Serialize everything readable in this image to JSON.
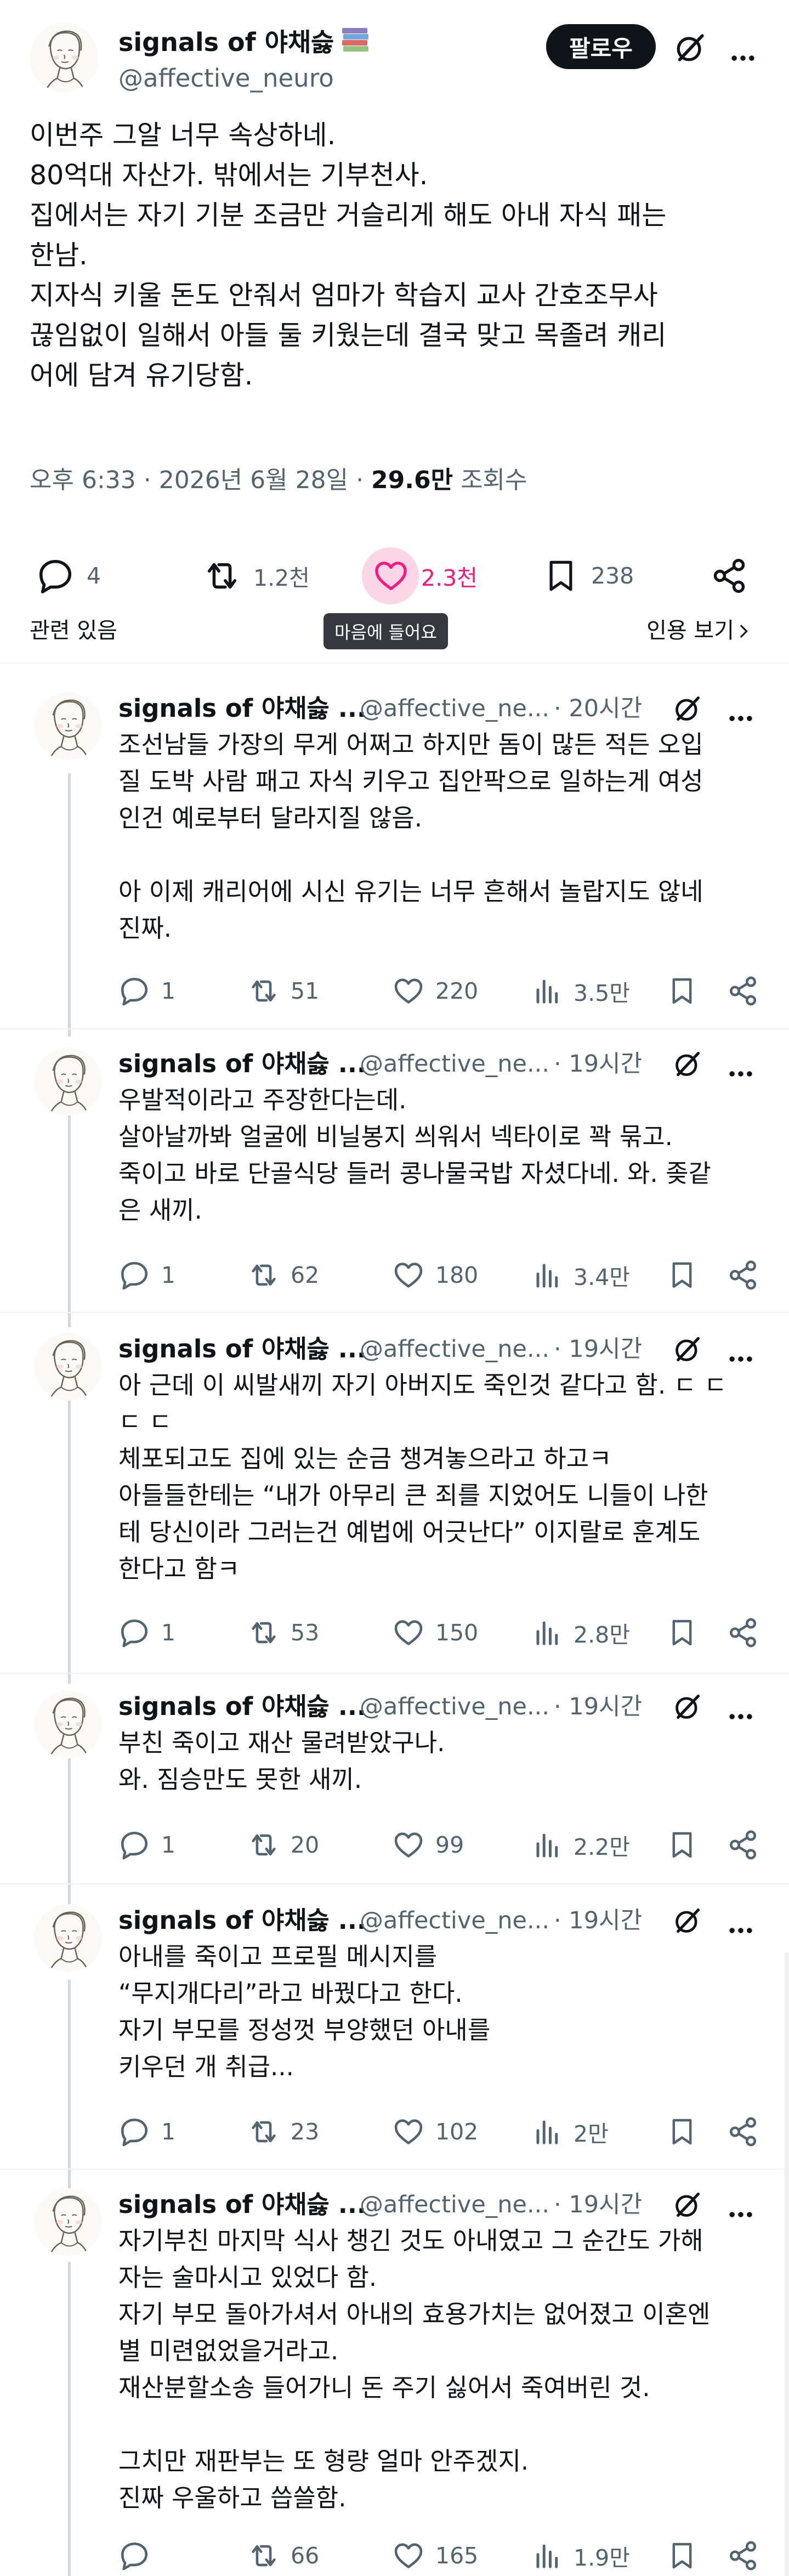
{
  "post": {
    "author_name": "signals of 야채슳",
    "author_handle": "@affective_neuro",
    "follow_label": "팔로우",
    "text_lines": [
      "이번주 그알 너무 속상하네.",
      "80억대 자산가. 밖에서는 기부천사.",
      "집에서는 자기 기분 조금만 거슬리게 해도 아내 자식 패는",
      "한남.",
      "지자식 키울 돈도 안줘서 엄마가 학습지 교사 간호조무사",
      "끊임없이 일해서 아들 둘 키웠는데 결국 맞고 목졸려 캐리",
      "어에 담겨 유기당함."
    ],
    "time": "오후 6:33 · 2026년 6월 28일 · ",
    "views_count": "29.6만",
    "views_label": " 조회수",
    "actions": {
      "replies": "4",
      "reposts": "1.2천",
      "likes": "2.3천",
      "bookmarks": "238"
    },
    "related_label": "관련 있음",
    "like_tooltip": "마음에 들어요",
    "quotes_label": "인용 보기"
  },
  "replies": [
    {
      "name": "signals of 야채슳 ...",
      "handle": "@affective_ne...",
      "time": "· 20시간",
      "text_lines": [
        "조선남들 가장의 무게 어쩌고 하지만 돔이 많든 적든 오입",
        "질 도박 사람 패고 자식 키우고 집안팍으로 일하는게 여성",
        "인건 예로부터 달라지질 않음.",
        "",
        "아 이제 캐리어에 시신 유기는 너무 흔해서 놀랍지도 않네",
        "진짜."
      ],
      "stats": {
        "replies": "1",
        "reposts": "51",
        "likes": "220",
        "views": "3.5만"
      }
    },
    {
      "name": "signals of 야채슳 ...",
      "handle": "@affective_ne...",
      "time": "· 19시간",
      "text_lines": [
        "우발적이라고 주장한다는데.",
        "살아날까봐 얼굴에 비닐봉지 씌워서 넥타이로 꽉 묶고.",
        "죽이고 바로 단골식당 들러 콩나물국밥 자셨다네. 와. 좆같",
        "은 새끼."
      ],
      "stats": {
        "replies": "1",
        "reposts": "62",
        "likes": "180",
        "views": "3.4만"
      }
    },
    {
      "name": "signals of 야채슳 ...",
      "handle": "@affective_ne...",
      "time": "· 19시간",
      "text_lines": [
        "아 근데 이 씨발새끼 자기 아버지도 죽인것 같다고 함. ㄷ ㄷ",
        "ㄷ ㄷ",
        "체포되고도 집에 있는 순금 챙겨놓으라고 하고ㅋ",
        "아들들한테는 “내가 아무리 큰 죄를 지었어도 니들이 나한",
        "테 당신이라 그러는건 예법에 어긋난다” 이지랄로 훈계도",
        "한다고 함ㅋ"
      ],
      "stats": {
        "replies": "1",
        "reposts": "53",
        "likes": "150",
        "views": "2.8만"
      }
    },
    {
      "name": "signals of 야채슳 ...",
      "handle": "@affective_ne...",
      "time": "· 19시간",
      "text_lines": [
        "부친 죽이고 재산 물려받았구나.",
        "와. 짐승만도 못한 새끼."
      ],
      "stats": {
        "replies": "1",
        "reposts": "20",
        "likes": "99",
        "views": "2.2만"
      }
    },
    {
      "name": "signals of 야채슳 ...",
      "handle": "@affective_ne...",
      "time": "· 19시간",
      "text_lines": [
        "아내를 죽이고 프로필 메시지를",
        "“무지개다리”라고 바꿨다고 한다.",
        "자기 부모를 정성껏 부양했던 아내를",
        "키우던 개 취급..."
      ],
      "stats": {
        "replies": "1",
        "reposts": "23",
        "likes": "102",
        "views": "2만"
      }
    },
    {
      "name": "signals of 야채슳 ...",
      "handle": "@affective_ne...",
      "time": "· 19시간",
      "text_lines": [
        "자기부친 마지막 식사 챙긴 것도 아내였고 그 순간도 가해",
        "자는 술마시고 있었다 함.",
        "자기 부모 돌아가셔서 아내의 효용가치는 없어졌고 이혼엔",
        "별 미련없었을거라고.",
        "재산분할소송 들어가니 돈 주기 싫어서 죽여버린 것.",
        "",
        "그치만 재판부는 또 형량 얼마 안주겠지.",
        "진짜 우울하고 씁쓸함."
      ],
      "stats": {
        "replies": "",
        "reposts": "66",
        "likes": "165",
        "views": "1.9만"
      }
    }
  ]
}
